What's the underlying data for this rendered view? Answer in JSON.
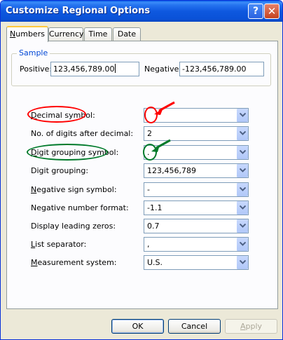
{
  "window": {
    "title": "Customize Regional Options",
    "help_glyph": "?",
    "close_glyph": "✕"
  },
  "tabs": [
    {
      "label": "Numbers",
      "key": "N",
      "rest": "umbers",
      "active": true
    },
    {
      "label": "Currency",
      "key": "",
      "rest": "Currency",
      "active": false
    },
    {
      "label": "Time",
      "key": "",
      "rest": "Time",
      "active": false
    },
    {
      "label": "Date",
      "key": "",
      "rest": "Date",
      "active": false
    }
  ],
  "sample": {
    "group_title": "Sample",
    "positive_label": "Positive:",
    "positive_value": "123,456,789.00",
    "negative_label": "Negative:",
    "negative_value": "-123,456,789.00"
  },
  "settings": [
    {
      "key": "D",
      "rest": "ecimal symbol:",
      "value": ""
    },
    {
      "key": "",
      "rest": "No. of digits after decimal:",
      "value": "2"
    },
    {
      "key": "D",
      "rest": "igit grouping symbol:",
      "value": "."
    },
    {
      "key": "",
      "rest": "Digit grouping:",
      "value": "123,456,789"
    },
    {
      "key": "N",
      "rest": "egative sign symbol:",
      "value": "-"
    },
    {
      "key": "",
      "rest": "Negative number format:",
      "value": "-1.1"
    },
    {
      "key": "",
      "rest": "Display leading zeros:",
      "value": "0.7"
    },
    {
      "key": "L",
      "rest": "ist separator:",
      "value": ","
    },
    {
      "key": "M",
      "rest": "easurement system:",
      "value": "U.S."
    }
  ],
  "buttons": {
    "ok": "OK",
    "cancel": "Cancel",
    "apply": "Apply"
  },
  "colors": {
    "annotation_red": "#FF0000",
    "annotation_green": "#007A2A",
    "title_blue": "#0A52D8"
  },
  "icons": {
    "help": "help-icon",
    "close": "close-icon",
    "dropdown": "chevron-down-icon",
    "red_arrow": "arrow-icon",
    "green_arrow": "arrow-icon"
  }
}
